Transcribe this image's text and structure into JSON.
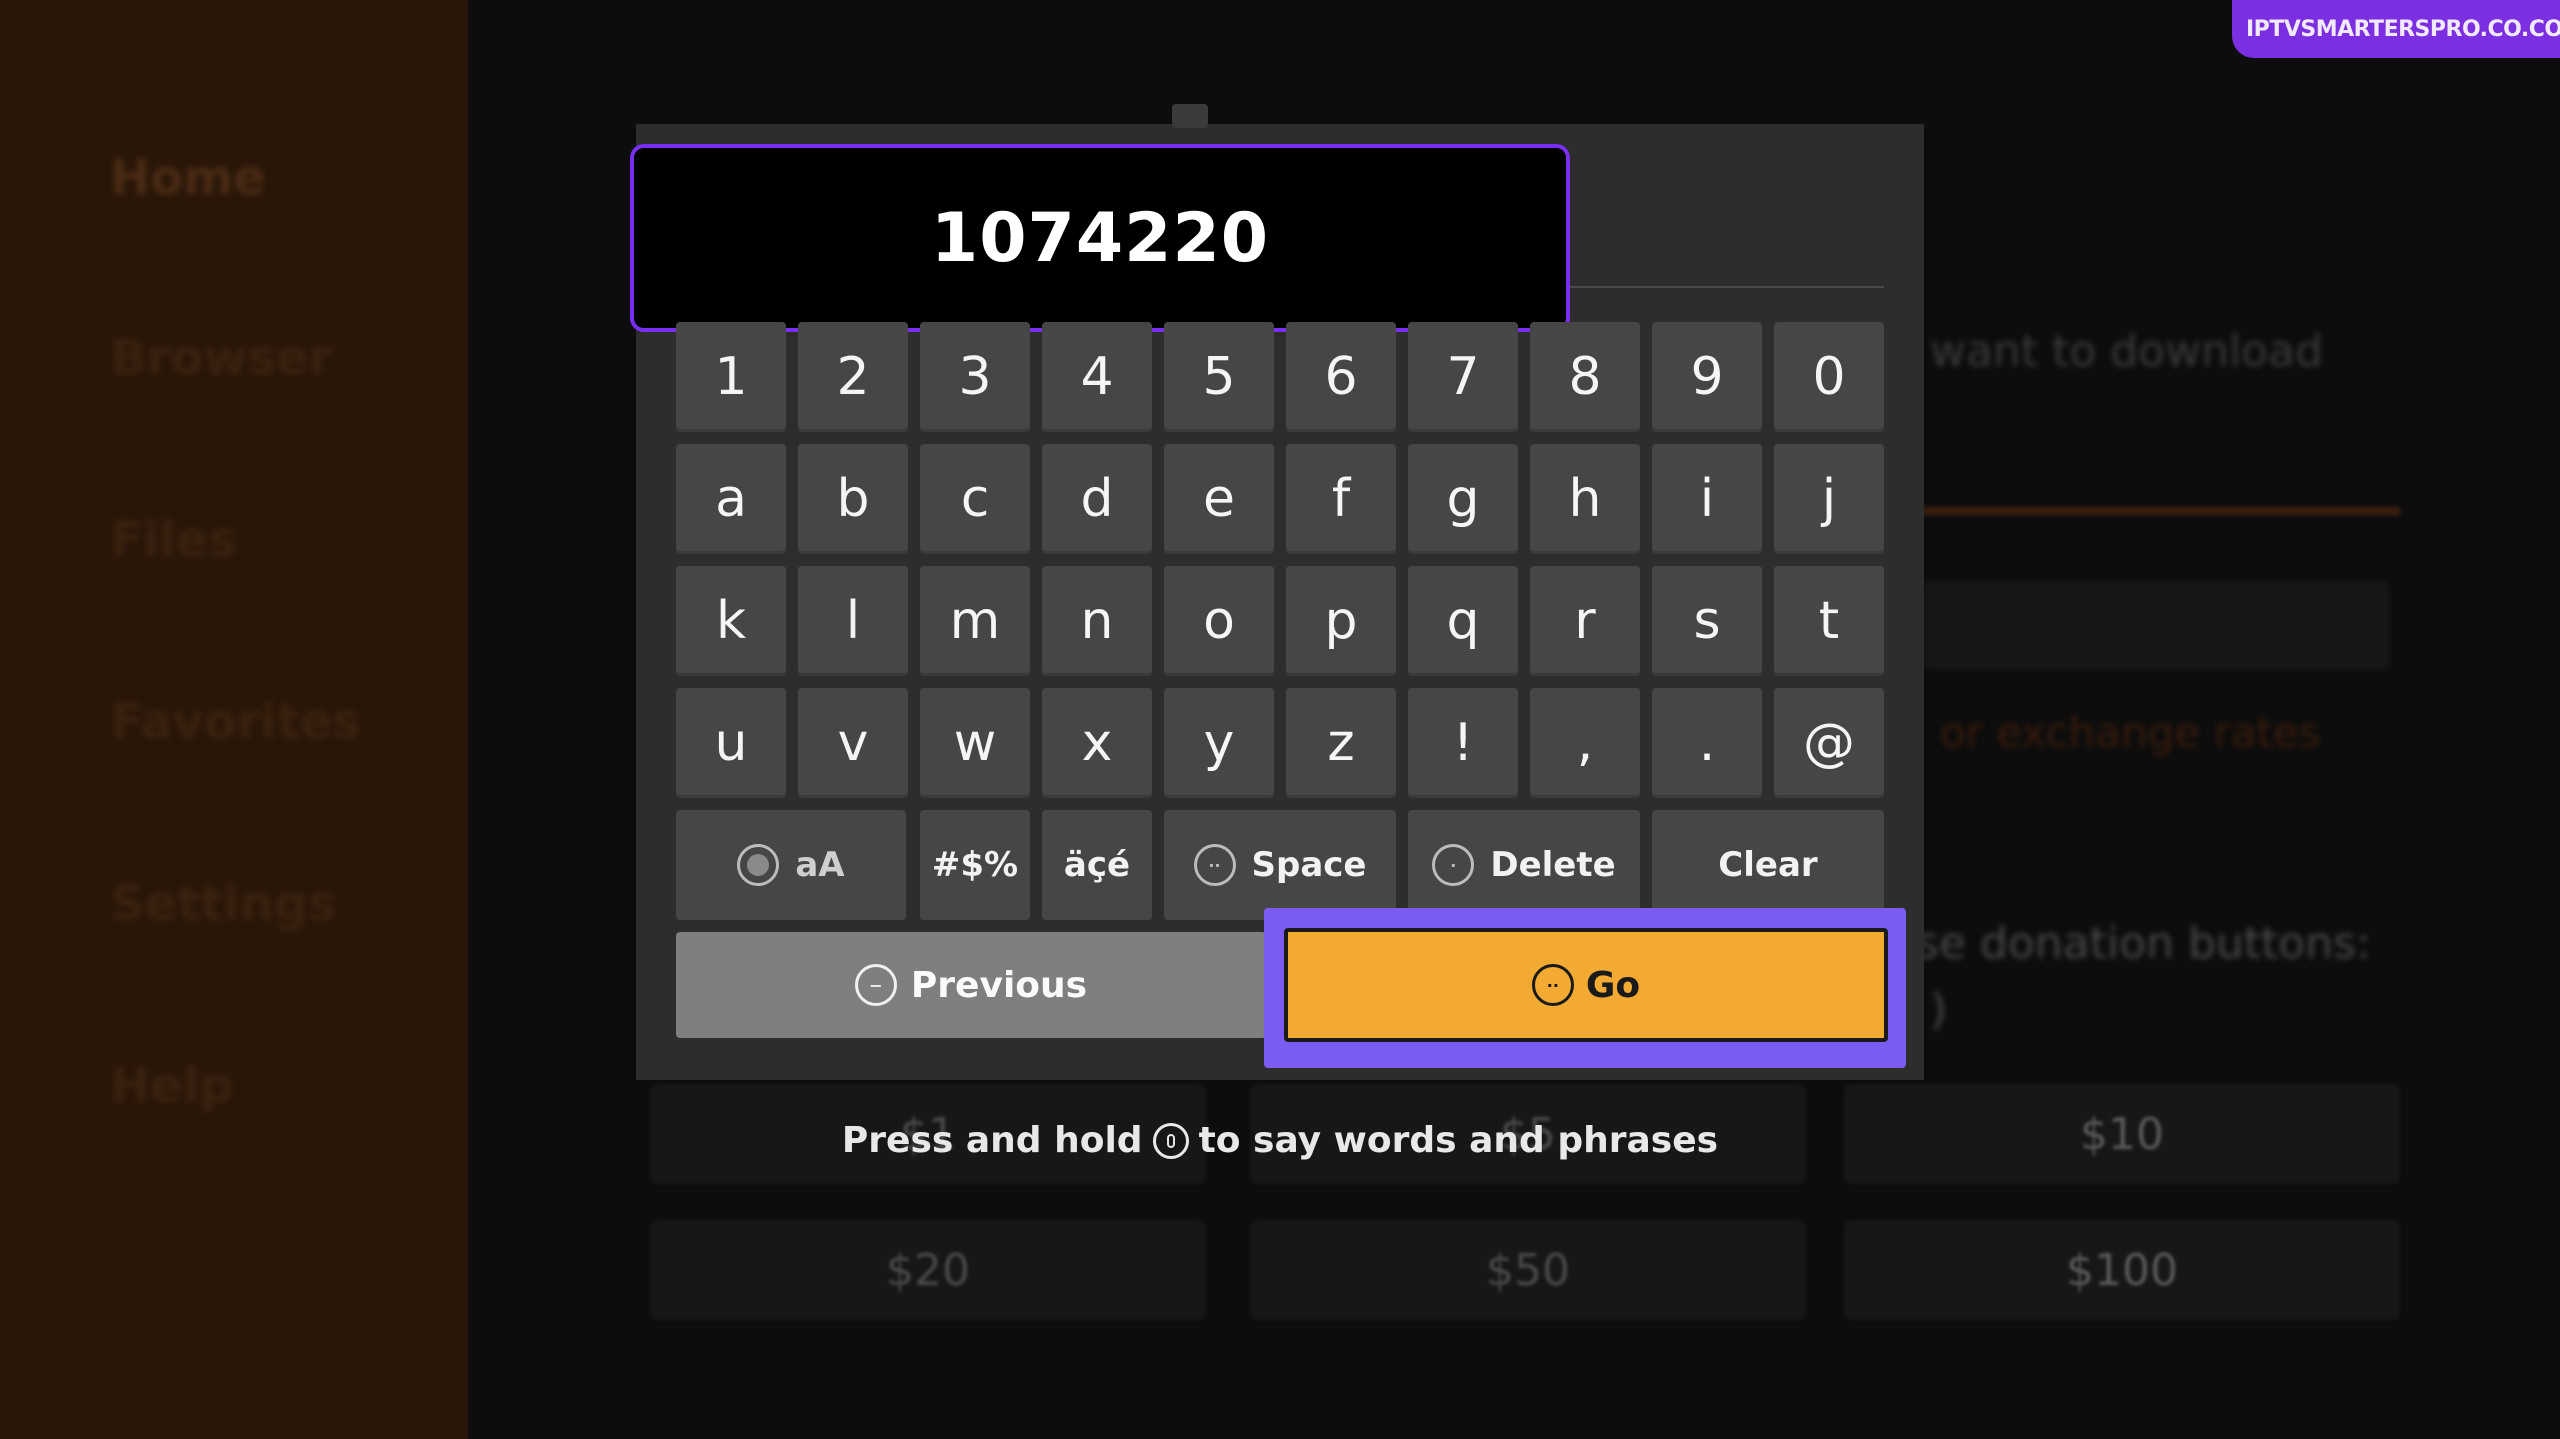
{
  "sidebar": {
    "items": [
      {
        "label": "Home"
      },
      {
        "label": "Browser"
      },
      {
        "label": "Files"
      },
      {
        "label": "Favorites"
      },
      {
        "label": "Settings"
      },
      {
        "label": "Help"
      }
    ]
  },
  "brand": {
    "label": "IPTVSMARTERSPRO.CO.COM"
  },
  "background": {
    "prompt_text": "want to download",
    "link_text": "or exchange rates",
    "donation_text": "se donation buttons:",
    "donation_sub": ")",
    "donations": [
      "$1",
      "$5",
      "$10",
      "$20",
      "$50",
      "$100"
    ]
  },
  "keyboard": {
    "input_value": "1074220",
    "rows": [
      [
        "1",
        "2",
        "3",
        "4",
        "5",
        "6",
        "7",
        "8",
        "9",
        "0"
      ],
      [
        "a",
        "b",
        "c",
        "d",
        "e",
        "f",
        "g",
        "h",
        "i",
        "j"
      ],
      [
        "k",
        "l",
        "m",
        "n",
        "o",
        "p",
        "q",
        "r",
        "s",
        "t"
      ],
      [
        "u",
        "v",
        "w",
        "x",
        "y",
        "z",
        "!",
        ",",
        ".",
        "@"
      ]
    ],
    "case_label": "aA",
    "symbols_label": "#$%",
    "accents_label": "äçé",
    "space_label": "Space",
    "delete_label": "Delete",
    "clear_label": "Clear",
    "previous_label": "Previous",
    "go_label": "Go",
    "hint_before": "Press and hold",
    "hint_after": "to say words and phrases"
  },
  "colors": {
    "accent_purple": "#7a2ff0",
    "focus_frame": "#7a5cf2",
    "go_orange": "#f2aa32",
    "key_gray": "#464646"
  }
}
